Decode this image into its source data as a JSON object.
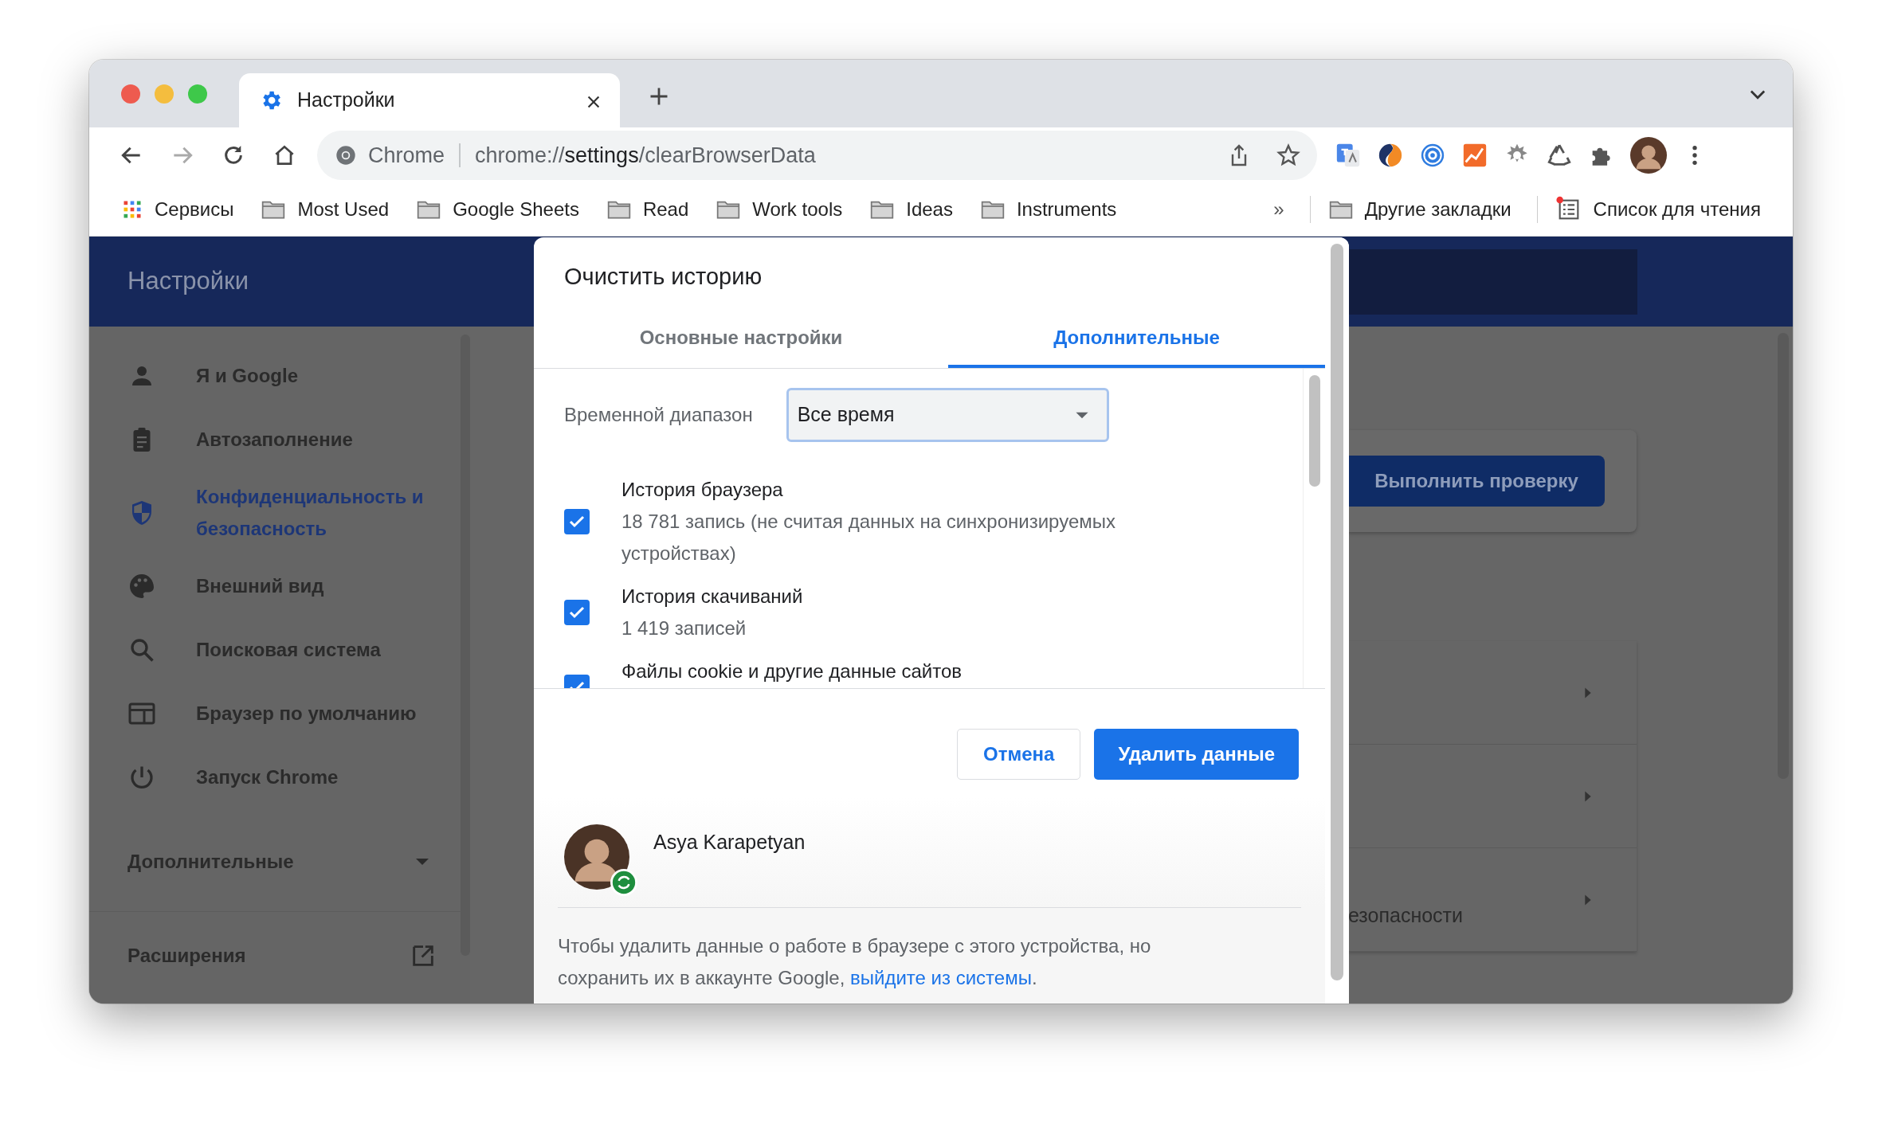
{
  "tabs": [
    {
      "title": "Настройки",
      "selected": true
    }
  ],
  "omnibox": {
    "site_label": "Chrome",
    "url": "chrome://**settings**/clearBrowserData"
  },
  "bookmarks": [
    {
      "kind": "apps",
      "label": "Сервисы"
    },
    {
      "kind": "folder",
      "label": "Most Used"
    },
    {
      "kind": "folder",
      "label": "Google Sheets"
    },
    {
      "kind": "folder",
      "label": "Read"
    },
    {
      "kind": "folder",
      "label": "Work tools"
    },
    {
      "kind": "folder",
      "label": "Ideas"
    },
    {
      "kind": "folder",
      "label": "Instruments"
    }
  ],
  "bookmarks_more": "»",
  "other_bookmarks": {
    "label": "Другие закладки"
  },
  "reading_list": {
    "label": "Список для чтения",
    "unread": true
  },
  "settings": {
    "title": "Настройки",
    "sidebar": [
      {
        "label": "Я и Google",
        "selected": false
      },
      {
        "label": "Автозаполнение",
        "selected": false
      },
      {
        "label": "Конфиденциальность и безопасность",
        "selected": true
      },
      {
        "label": "Внешний вид",
        "selected": false
      },
      {
        "label": "Поисковая система",
        "selected": false
      },
      {
        "label": "Браузер по умолчанию",
        "selected": false
      },
      {
        "label": "Запуск Chrome",
        "selected": false
      }
    ],
    "advanced": {
      "label": "Дополнительные",
      "expanded": false
    },
    "extensions": {
      "label": "Расширения"
    },
    "check_button": "Выполнить проверку",
    "rows": [
      {
        "text": ""
      },
      {
        "text": ""
      },
      {
        "text": "езопасности"
      }
    ]
  },
  "dialog": {
    "title": "Очистить историю",
    "tabs": [
      {
        "label": "Основные настройки",
        "selected": false
      },
      {
        "label": "Дополнительные",
        "selected": true
      }
    ],
    "time_range": {
      "label": "Временной диапазон",
      "value": "Все время"
    },
    "items": [
      {
        "title": "История браузера",
        "detail": "18 781 запись (не считая данных на синхронизируемых устройствах)",
        "checked": true
      },
      {
        "title": "История скачиваний",
        "detail": "1 419 записей",
        "checked": true
      },
      {
        "title": "Файлы cookie и другие данные сайтов",
        "checked": true
      }
    ],
    "buttons": [
      {
        "label": "Отмена",
        "kind": "secondary"
      },
      {
        "label": "Удалить данные",
        "kind": "primary"
      }
    ],
    "account": {
      "name": "Asya Karapetyan",
      "synced": true
    },
    "footer": {
      "text": "Чтобы удалить данные о работе в браузере с этого устройства, но сохранить их в аккаунте Google,",
      "link": "выйдите из системы",
      "after": "."
    }
  }
}
